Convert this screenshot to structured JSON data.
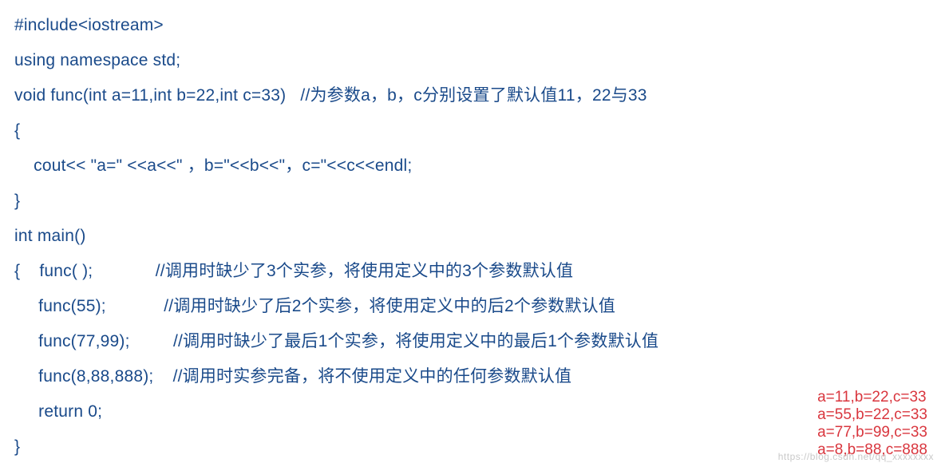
{
  "code": {
    "lines": [
      "#include<iostream>",
      "using namespace std;",
      "void func(int a=11,int b=22,int c=33)   //为参数a，b，c分别设置了默认值11，22与33",
      "{",
      "    cout<< \"a=\" <<a<<\" ，b=\"<<b<<\"，c=\"<<c<<endl;",
      "}",
      "int main()",
      "{    func( );             //调用时缺少了3个实参，将使用定义中的3个参数默认值",
      "     func(55);            //调用时缺少了后2个实参，将使用定义中的后2个参数默认值",
      "     func(77,99);         //调用时缺少了最后1个实参，将使用定义中的最后1个参数默认值",
      "     func(8,88,888);    //调用时实参完备，将不使用定义中的任何参数默认值",
      "     return 0;",
      "}"
    ]
  },
  "output": {
    "lines": [
      "a=11,b=22,c=33",
      "a=55,b=22,c=33",
      "a=77,b=99,c=33",
      "a=8,b=88,c=888"
    ]
  },
  "watermark": "https://blog.csdn.net/qq_xxxxxxxx"
}
